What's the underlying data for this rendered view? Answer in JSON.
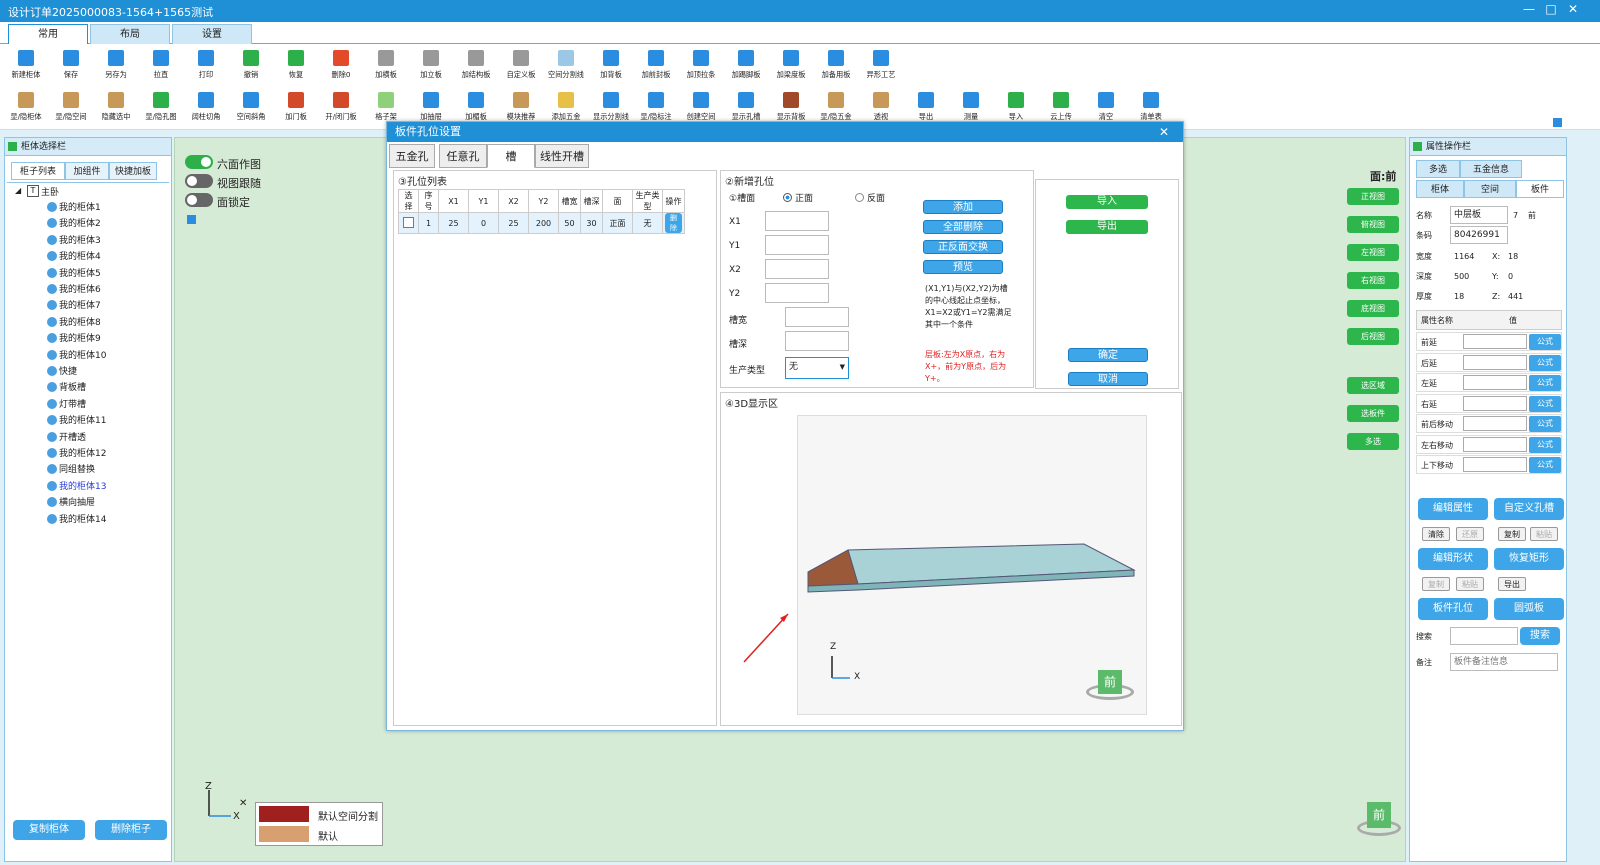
{
  "app": {
    "title": "设计订单2025000083-1564+1565测试",
    "win_min": "—",
    "win_max": "□",
    "win_close": "✕"
  },
  "ribbon_tabs": [
    "常用",
    "布局",
    "设置"
  ],
  "toolbar_row1": [
    {
      "label": "新建柜体",
      "color": "#2a8de0"
    },
    {
      "label": "保存",
      "color": "#2a8de0"
    },
    {
      "label": "另存为",
      "color": "#2a8de0"
    },
    {
      "label": "拉直",
      "color": "#2a8de0"
    },
    {
      "label": "打印",
      "color": "#2a8de0"
    },
    {
      "label": "撤销",
      "color": "#2db04a"
    },
    {
      "label": "恢复",
      "color": "#2db04a"
    },
    {
      "label": "删除0",
      "color": "#e24a2a"
    },
    {
      "label": "加横板",
      "color": "#999999"
    },
    {
      "label": "加立板",
      "color": "#999999"
    },
    {
      "label": "加结构板",
      "color": "#999999"
    },
    {
      "label": "自定义板",
      "color": "#999999"
    },
    {
      "label": "空间分割线",
      "color": "#9cc8e8"
    },
    {
      "label": "加背板",
      "color": "#2a8de0"
    },
    {
      "label": "加前封板",
      "color": "#2a8de0"
    },
    {
      "label": "加顶拉条",
      "color": "#2a8de0"
    },
    {
      "label": "加踢脚板",
      "color": "#2a8de0"
    },
    {
      "label": "加梁度板",
      "color": "#2a8de0"
    },
    {
      "label": "加备用板",
      "color": "#2a8de0"
    },
    {
      "label": "异形工艺",
      "color": "#2a8de0"
    }
  ],
  "toolbar_row2": [
    {
      "label": "显/隐柜体",
      "color": "#c89858"
    },
    {
      "label": "显/隐空间",
      "color": "#c89858"
    },
    {
      "label": "隐藏选中",
      "color": "#c89858"
    },
    {
      "label": "显/隐孔图",
      "color": "#2db04a"
    },
    {
      "label": "阔柱切角",
      "color": "#2a8de0"
    },
    {
      "label": "空间斜角",
      "color": "#2a8de0"
    },
    {
      "label": "加门板",
      "color": "#d24a2a"
    },
    {
      "label": "开/闭门板",
      "color": "#d24a2a"
    },
    {
      "label": "格子架",
      "color": "#8fd07a"
    },
    {
      "label": "加抽屉",
      "color": "#2a8de0"
    },
    {
      "label": "加楣板",
      "color": "#2a8de0"
    },
    {
      "label": "模块推荐",
      "color": "#c89858"
    },
    {
      "label": "添加五金",
      "color": "#e8c048"
    },
    {
      "label": "显示分割线",
      "color": "#2a8de0"
    },
    {
      "label": "显/隐标注",
      "color": "#2a8de0"
    },
    {
      "label": "创建空间",
      "color": "#2a8de0"
    },
    {
      "label": "显示孔槽",
      "color": "#2a8de0"
    },
    {
      "label": "显示背板",
      "color": "#a04a2a"
    },
    {
      "label": "显/隐五金",
      "color": "#c89858"
    },
    {
      "label": "透视",
      "color": "#c89858"
    },
    {
      "label": "导出",
      "color": "#2a8de0"
    },
    {
      "label": "测量",
      "color": "#2a8de0"
    },
    {
      "label": "导入",
      "color": "#2db04a"
    },
    {
      "label": "云上传",
      "color": "#2db04a"
    },
    {
      "label": "清空",
      "color": "#2a8de0"
    },
    {
      "label": "清单表",
      "color": "#2a8de0"
    }
  ],
  "left_panel": {
    "title": "柜体选择栏",
    "tabs": [
      "柜子列表",
      "加组件",
      "快捷加板"
    ],
    "root": "主卧",
    "items": [
      "我的柜体1",
      "我的柜体2",
      "我的柜体3",
      "我的柜体4",
      "我的柜体5",
      "我的柜体6",
      "我的柜体7",
      "我的柜体8",
      "我的柜体9",
      "我的柜体10",
      "快捷",
      "背板槽",
      "灯带槽",
      "我的柜体11",
      "开槽透",
      "我的柜体12",
      "同组替换",
      "我的柜体13",
      "横向抽屉",
      "我的柜体14"
    ],
    "selected": "我的柜体13",
    "copy_btn": "复制柜体",
    "delete_btn": "删除柜子"
  },
  "center": {
    "toggles": [
      {
        "label": "六面作图",
        "on": true
      },
      {
        "label": "视图跟随",
        "on": false
      },
      {
        "label": "面锁定",
        "on": false
      }
    ],
    "face_label": "面:前",
    "view_buttons": [
      "正视图",
      "俯视图",
      "左视图",
      "右视图",
      "底视图",
      "后视图"
    ],
    "select_buttons": [
      "选区域",
      "选板件",
      "多选"
    ],
    "legend": [
      {
        "label": "默认空间分割",
        "color": "#a02020"
      },
      {
        "label": "默认",
        "color": "#d8a070"
      }
    ],
    "axis_z": "Z",
    "axis_x": "X",
    "cube_label": "前"
  },
  "dialog": {
    "title": "板件孔位设置",
    "close": "✕",
    "tabs": [
      "五金孔",
      "任意孔",
      "槽",
      "线性开槽"
    ],
    "active_tab": "槽",
    "list_caption": "③孔位列表",
    "columns": [
      "选择",
      "序号",
      "X1",
      "Y1",
      "X2",
      "Y2",
      "槽宽",
      "槽深",
      "面",
      "生产类型",
      "操作"
    ],
    "rows": [
      {
        "seq": "1",
        "x1": "25",
        "y1": "0",
        "x2": "25",
        "y2": "200",
        "w": "50",
        "d": "30",
        "face": "正面",
        "type": "无",
        "op": "删除"
      }
    ],
    "new_caption": "②新增孔位",
    "face_field": "①槽面",
    "face_front": "正面",
    "face_back": "反面",
    "fields": [
      "X1",
      "Y1",
      "X2",
      "Y2",
      "槽宽",
      "槽深",
      "生产类型"
    ],
    "prod_type_value": "无",
    "btn_add": "添加",
    "btn_clear": "全部删除",
    "btn_swap": "正反面交换",
    "btn_preview": "预览",
    "note": "(X1,Y1)与(X2,Y2)为槽的中心线起止点坐标，X1=X2或Y1=Y2需满足其中一个条件",
    "warn": "层板:左为X原点，右为X+，前为Y原点，后为Y+。",
    "btn_import": "导入",
    "btn_export": "导出",
    "btn_ok": "确定",
    "btn_cancel": "取消",
    "view3d_caption": "④3D显示区",
    "axis_z": "Z",
    "axis_x": "X",
    "cube_label": "前"
  },
  "right_panel": {
    "title": "属性操作栏",
    "tabs_row1": [
      "多选",
      "五金信息"
    ],
    "tabs_row2": [
      "柜体",
      "空间",
      "板件"
    ],
    "name_label": "名称",
    "name_value": "中层板",
    "name_extra": "7",
    "name_extra2": "前",
    "code_label": "条码",
    "code_value": "80426991",
    "props": [
      {
        "k": "宽度",
        "v": "1164",
        "k2": "X:",
        "v2": "18"
      },
      {
        "k": "深度",
        "v": "500",
        "k2": "Y:",
        "v2": "0"
      },
      {
        "k": "厚度",
        "v": "18",
        "k2": "Z:",
        "v2": "441"
      }
    ],
    "attr_head": [
      "属性名称",
      "值"
    ],
    "attrs": [
      "前延",
      "后延",
      "左延",
      "右延",
      "前后移动",
      "左右移动",
      "上下移动"
    ],
    "formula": "公式",
    "btn_edit_attr": "编辑属性",
    "btn_custom_hole": "自定义孔槽",
    "btn_clear": "清除",
    "btn_restore": "还原",
    "btn_copy": "复制",
    "btn_paste": "粘贴",
    "btn_edit_shape": "编辑形状",
    "btn_restore_rect": "恢复矩形",
    "btn_copy2": "复制",
    "btn_paste2": "粘贴",
    "btn_export": "导出",
    "btn_board_hole": "板件孔位",
    "btn_arc_board": "圆弧板",
    "search_label": "搜索",
    "search_btn": "搜索",
    "remark_label": "备注",
    "remark_placeholder": "板件备注信息"
  }
}
